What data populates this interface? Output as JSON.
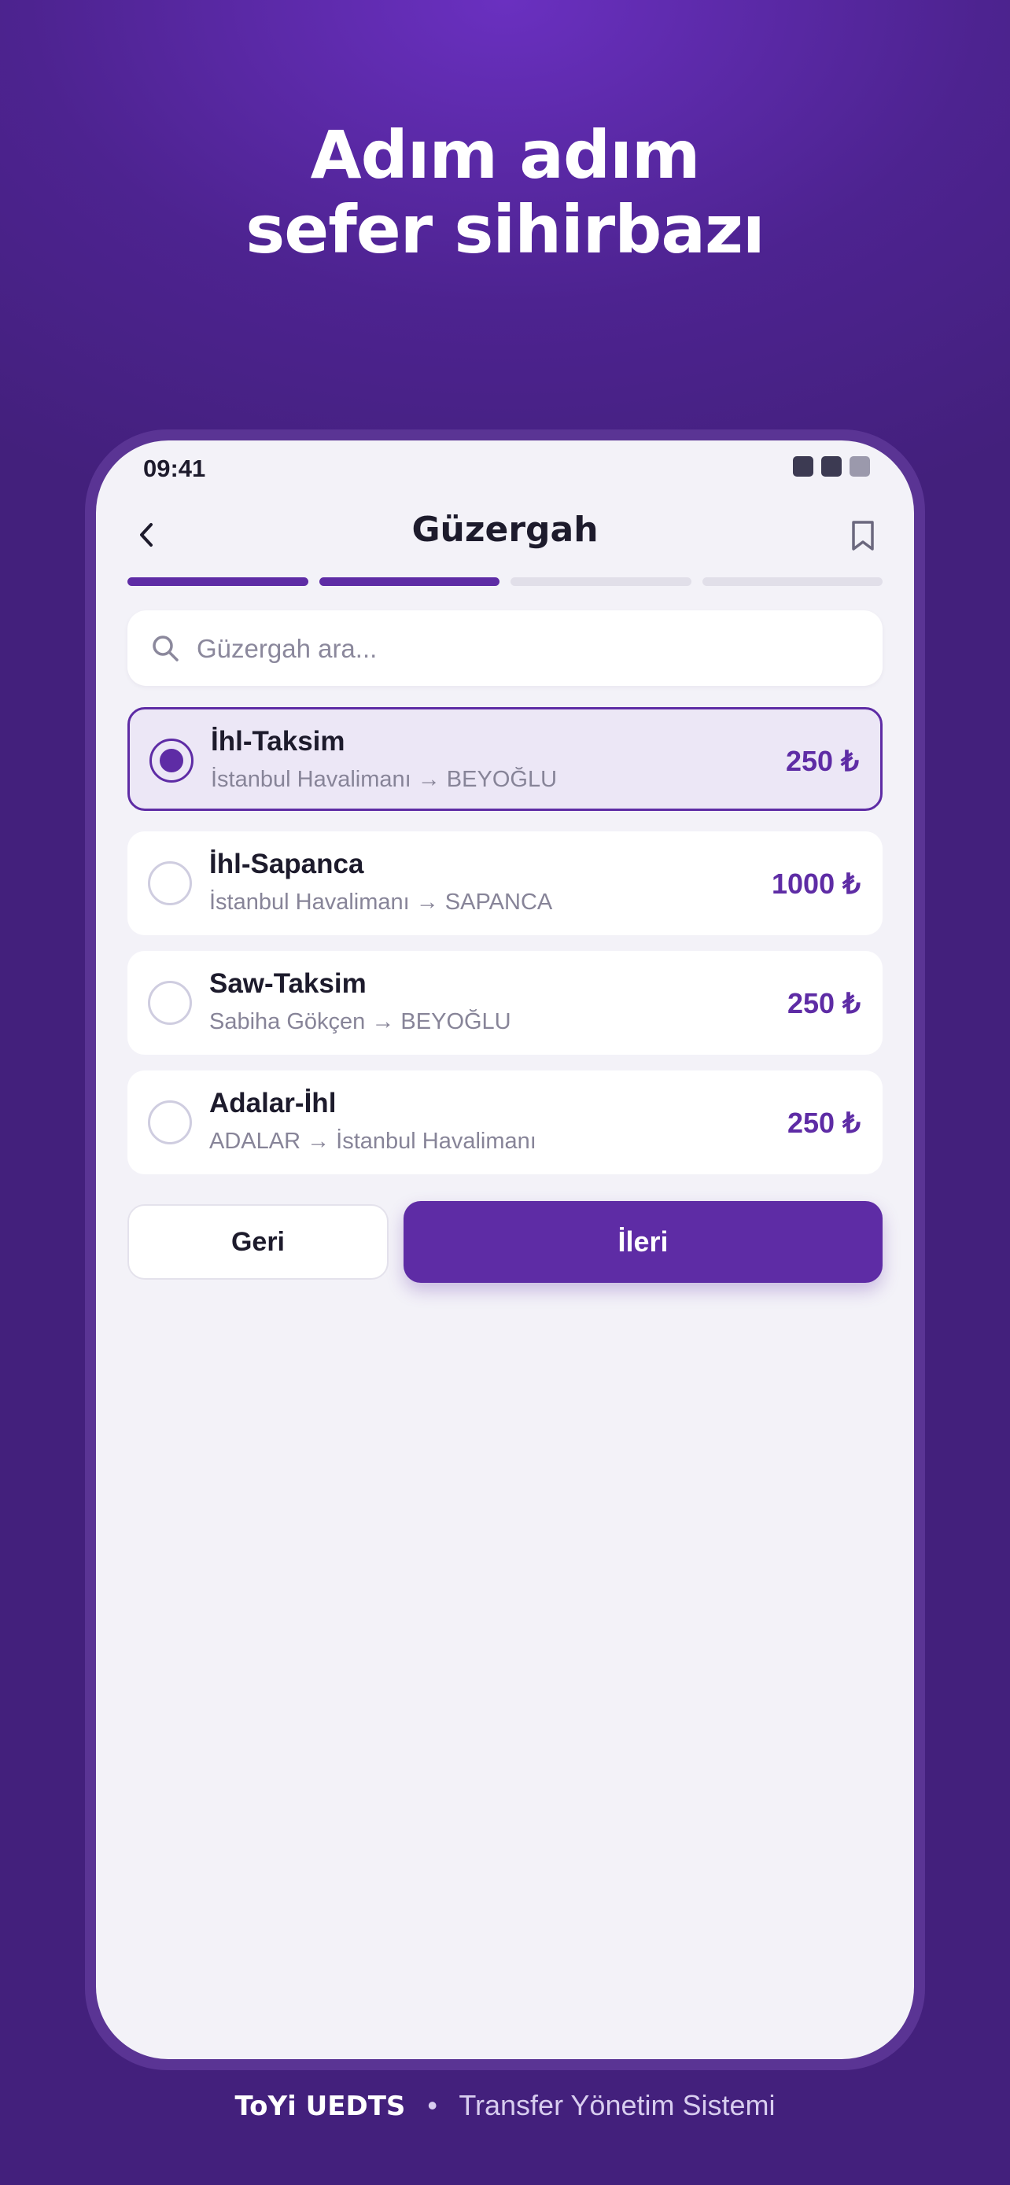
{
  "hero": {
    "line1": "Adım adım",
    "line2": "sefer sihirbazı"
  },
  "status_bar": {
    "time": "09:41"
  },
  "header": {
    "title": "Güzergah",
    "back_icon": "chevron-left-icon",
    "bookmark_icon": "bookmark-icon"
  },
  "progress": {
    "total_steps": 4,
    "current_step": 2
  },
  "search": {
    "placeholder": "Güzergah ara...",
    "value": ""
  },
  "routes": [
    {
      "name": "İhl-Taksim",
      "route": "İstanbul Havalimanı → BEYOĞLU",
      "price": "250 ₺",
      "selected": true
    },
    {
      "name": "İhl-Sapanca",
      "route": "İstanbul Havalimanı → SAPANCA",
      "price": "1000 ₺",
      "selected": false
    },
    {
      "name": "Saw-Taksim",
      "route": "Sabiha Gökçen → BEYOĞLU",
      "price": "250 ₺",
      "selected": false
    },
    {
      "name": "Adalar-İhl",
      "route": "ADALAR → İstanbul Havalimanı",
      "price": "250 ₺",
      "selected": false
    }
  ],
  "actions": {
    "back_label": "Geri",
    "next_label": "İleri"
  },
  "footer": {
    "brand": "ToYi UEDTS",
    "separator": "•",
    "tagline": "Transfer Yönetim Sistemi"
  },
  "colors": {
    "accent": "#5e2ca5",
    "background": "#4d2390",
    "surface": "#f3f2f8"
  }
}
